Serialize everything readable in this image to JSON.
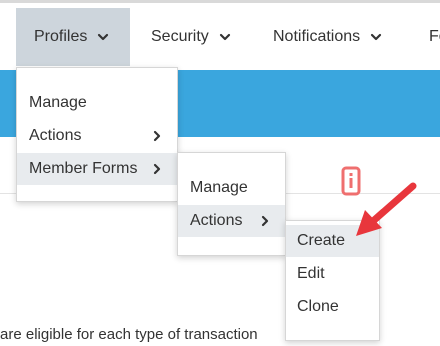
{
  "navbar": {
    "items": [
      {
        "label": "Profiles"
      },
      {
        "label": "Security"
      },
      {
        "label": "Notifications"
      },
      {
        "label": "Fo"
      }
    ]
  },
  "profiles_menu": {
    "items": [
      {
        "label": "Manage"
      },
      {
        "label": "Actions"
      },
      {
        "label": "Member Forms"
      }
    ]
  },
  "member_forms_menu": {
    "items": [
      {
        "label": "Manage"
      },
      {
        "label": "Actions"
      }
    ]
  },
  "actions_menu": {
    "items": [
      {
        "label": "Create"
      },
      {
        "label": "Edit"
      },
      {
        "label": "Clone"
      }
    ]
  },
  "body": {
    "text": "are eligible for each type of transaction"
  },
  "colors": {
    "nav_active_bg": "#cdd5dc",
    "band_blue": "#3aa6de",
    "info_icon": "#ef6f6f",
    "annotation_arrow": "#e8363c"
  }
}
